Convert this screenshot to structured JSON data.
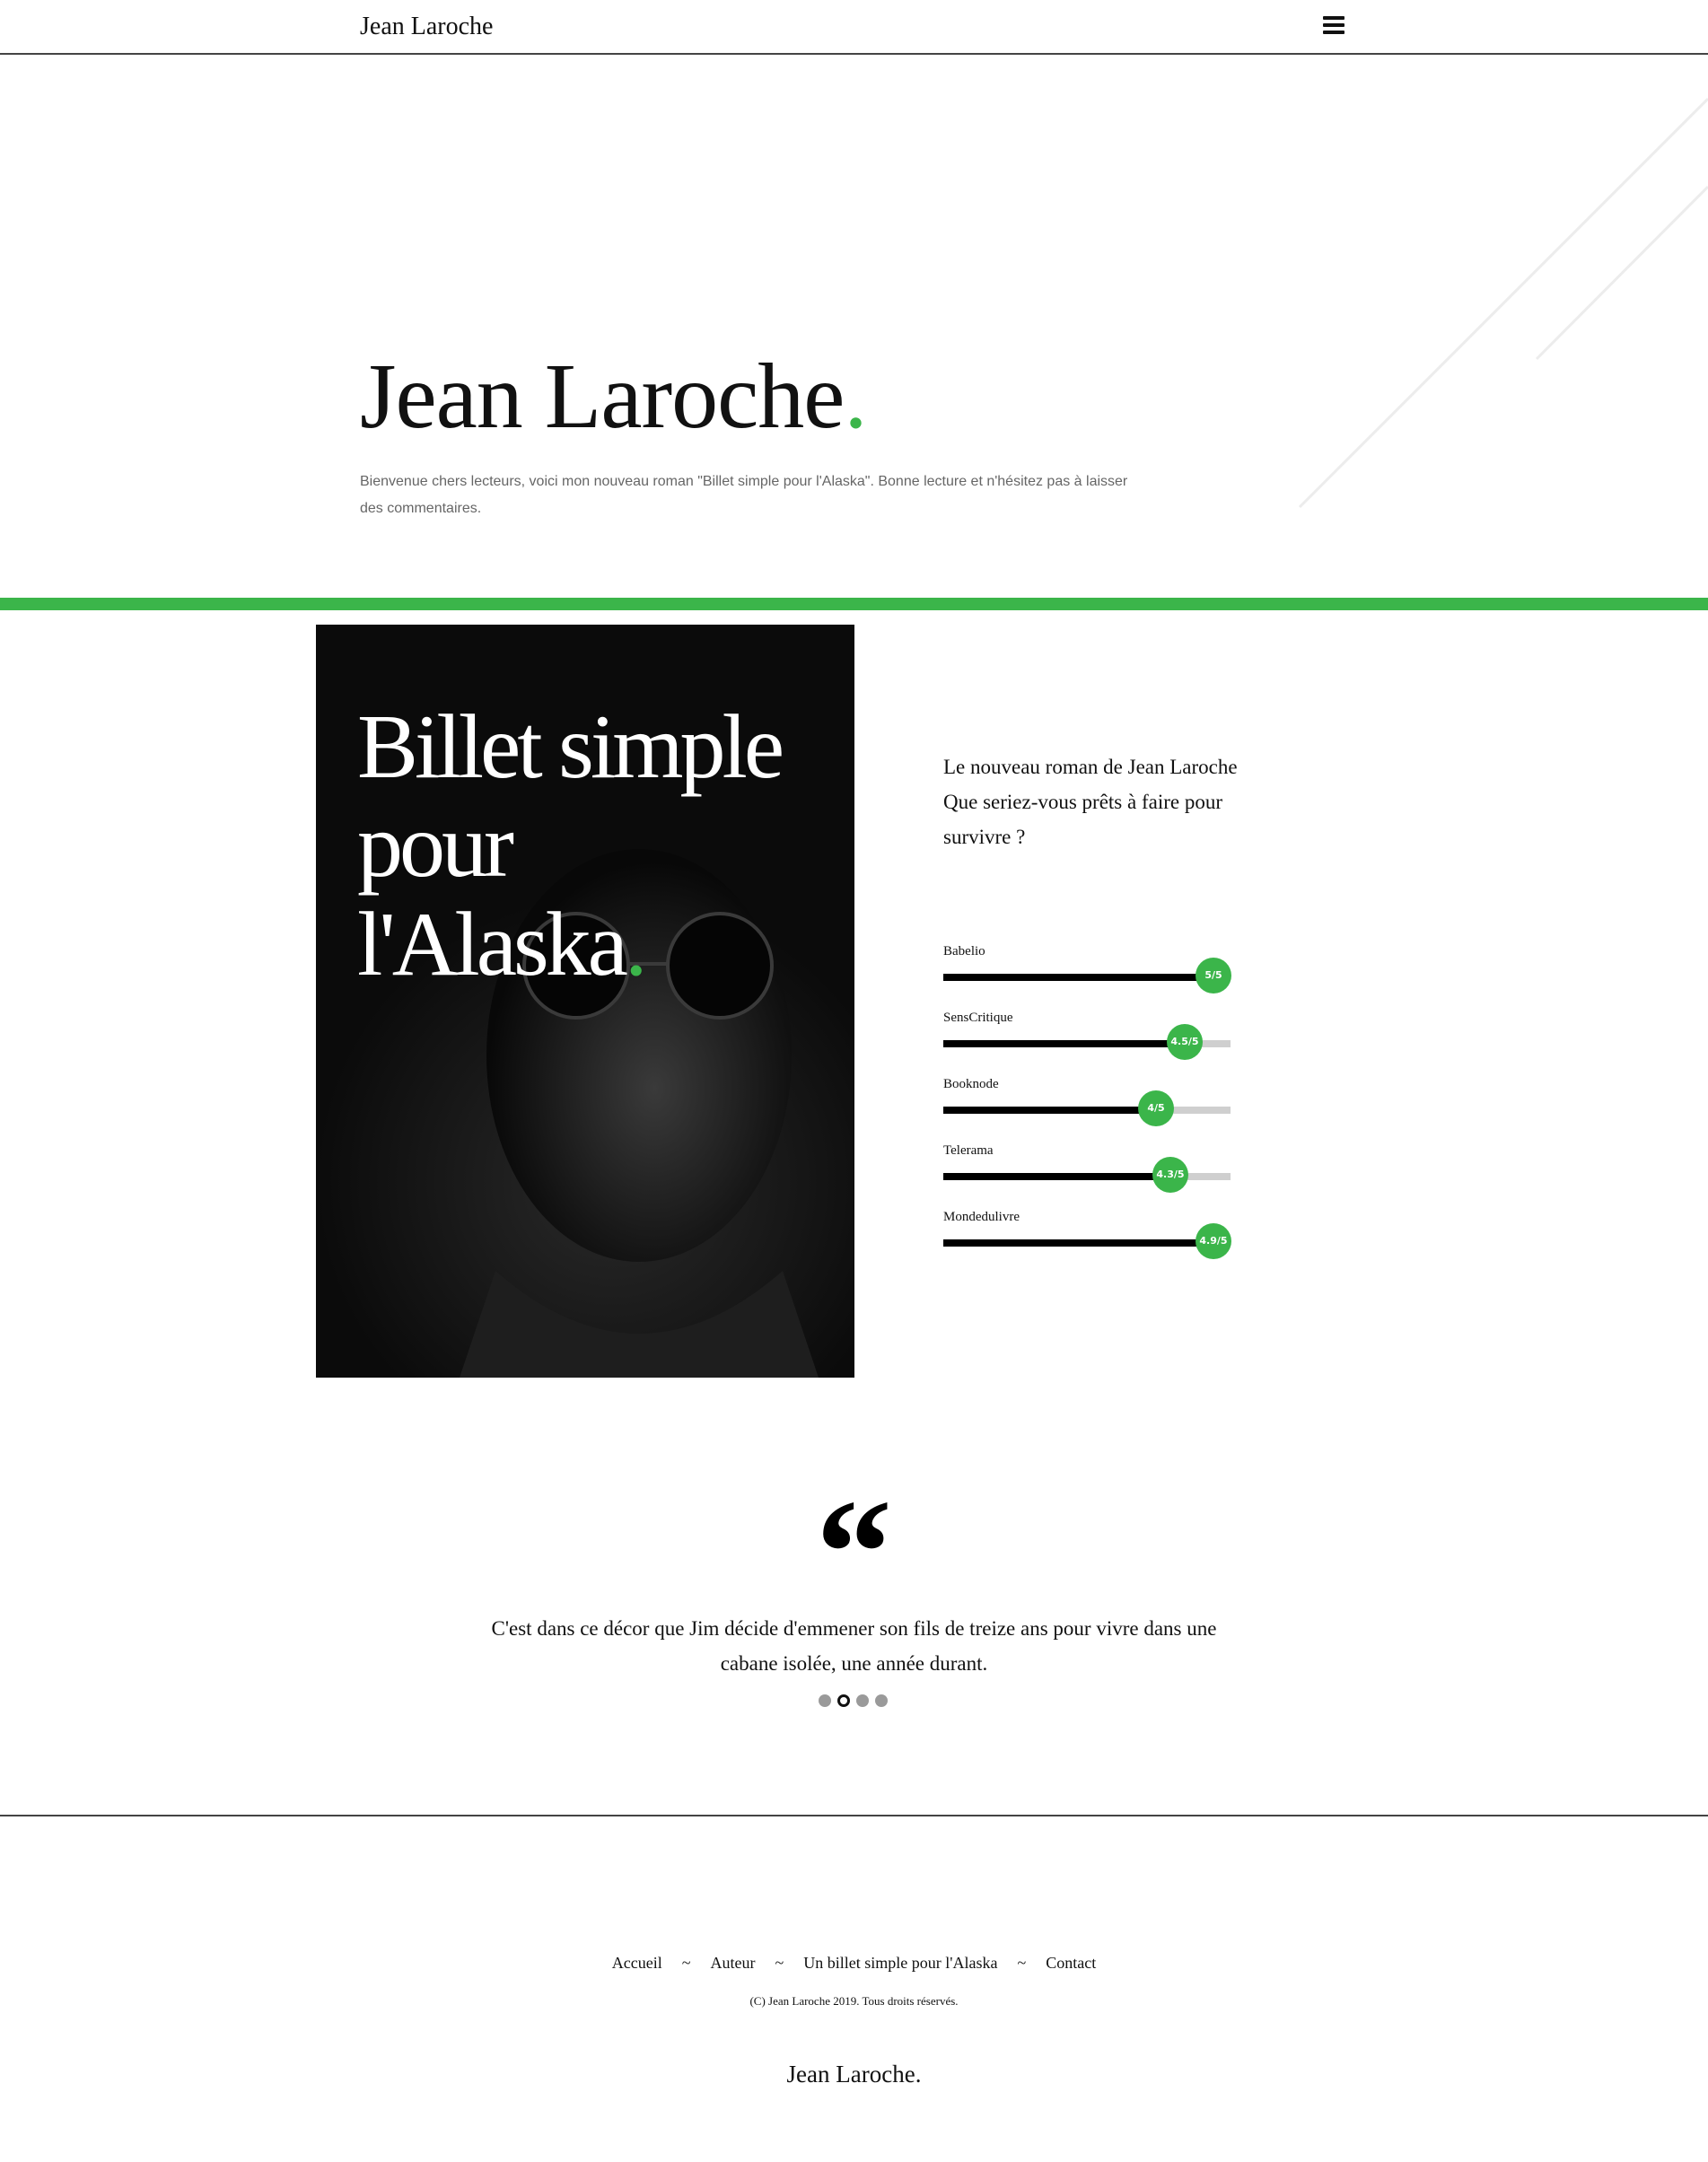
{
  "header": {
    "brand": "Jean Laroche",
    "menu_icon": "hamburger-menu-icon"
  },
  "hero": {
    "title": "Jean Laroche",
    "title_dot": ".",
    "intro": "Bienvenue chers lecteurs, voici mon nouveau roman \"Billet simple pour l'Alaska\". Bonne lecture et n'hésitez pas à laisser des commentaires."
  },
  "book": {
    "cover_lines": [
      "Billet simple",
      "pour",
      "l'Alaska"
    ],
    "cover_dot": ".",
    "description_lines": [
      "Le nouveau roman de Jean Laroche",
      "Que seriez-vous prêts à faire pour",
      "survivre ?"
    ]
  },
  "ratings": [
    {
      "source": "Babelio",
      "score": "5/5",
      "fraction": 0.94
    },
    {
      "source": "SensCritique",
      "score": "4.5/5",
      "fraction": 0.84
    },
    {
      "source": "Booknode",
      "score": "4/5",
      "fraction": 0.74
    },
    {
      "source": "Telerama",
      "score": "4.3/5",
      "fraction": 0.79
    },
    {
      "source": "Mondedulivre",
      "score": "4.9/5",
      "fraction": 0.94
    }
  ],
  "quote": {
    "mark": "“",
    "text_lines": [
      "C'est dans ce décor que Jim décide d'emmener son fils de treize ans pour vivre dans une",
      "cabane isolée, une année durant."
    ],
    "dot_count": 4,
    "active_dot": 1
  },
  "footer": {
    "nav": [
      "Accueil",
      "Auteur",
      "Un billet simple pour l'Alaska",
      "Contact"
    ],
    "separator": "~",
    "copyright": "(C) Jean Laroche 2019. Tous droits réservés.",
    "brand": "Jean Laroche."
  },
  "colors": {
    "accent": "#3bb54a",
    "rating_track": "#cfcfcf",
    "rating_fill": "#000000"
  }
}
